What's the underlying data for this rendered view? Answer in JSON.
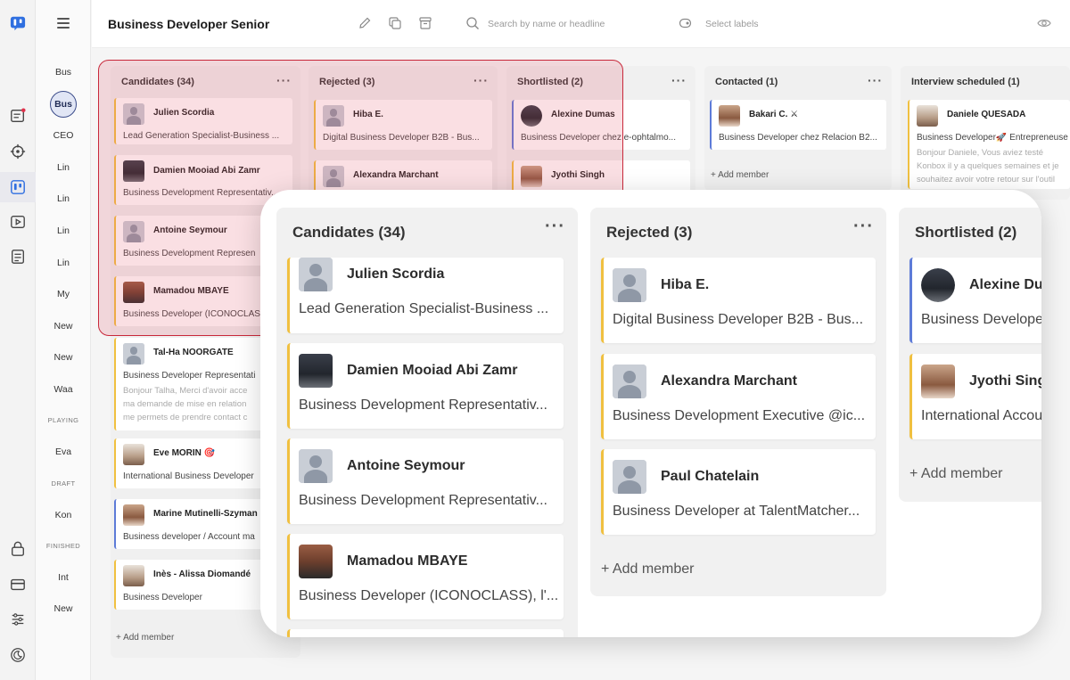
{
  "app": {
    "job_title": "Business Developer Senior"
  },
  "colors": {
    "accent": "#3b4c8a",
    "card_border": "#f0c040",
    "highlight": "#c8283a"
  },
  "header": {
    "search_placeholder": "Search by name or headline",
    "labels_placeholder": "Select labels"
  },
  "jobs": {
    "items": [
      "Bus",
      "Bus",
      "CEO",
      "Lin",
      "Lin",
      "Lin",
      "Lin",
      "My",
      "New",
      "New",
      "Waa"
    ],
    "playing_label": "PLAYING",
    "playing_items": [
      "Eva"
    ],
    "draft_label": "DRAFT",
    "draft_items": [
      "Kon"
    ],
    "finished_label": "FINISHED",
    "finished_items": [
      "Int",
      "New"
    ]
  },
  "board": {
    "add_member": "+ Add member",
    "columns": [
      {
        "title": "Candidates (34)",
        "cards": [
          {
            "name": "Julien Scordia",
            "headline": "Lead Generation Specialist-Business ..."
          },
          {
            "name": "Damien Mooiad Abi Zamr",
            "headline": "Business Development Representativ..."
          },
          {
            "name": "Antoine Seymour",
            "headline": "Business Development Represen"
          },
          {
            "name": "Mamadou MBAYE",
            "headline": "Business Developer (ICONOCLAS"
          },
          {
            "name": "Tal-Ha NOORGATE",
            "headline": "Business Developer Representati",
            "message": [
              "Bonjour Talha, Merci d'avoir acce",
              "ma demande de mise en relation",
              "me permets de prendre contact c"
            ]
          },
          {
            "name": "Eve MORIN 🎯",
            "headline": "International Business Developer"
          },
          {
            "name": "Marine Mutinelli-Szyman",
            "headline": "Business developer / Account ma"
          },
          {
            "name": "Inès - Alissa Diomandé",
            "headline": "Business Developer"
          }
        ]
      },
      {
        "title": "Rejected (3)",
        "cards": [
          {
            "name": "Hiba E.",
            "headline": "Digital Business Developer B2B - Bus..."
          },
          {
            "name": "Alexandra Marchant",
            "headline": ""
          }
        ]
      },
      {
        "title": "Shortlisted (2)",
        "cards": [
          {
            "name": "Alexine Dumas",
            "headline": "Business Developer chez e-ophtalmo..."
          },
          {
            "name": "Jyothi Singh",
            "headline": ""
          }
        ]
      },
      {
        "title": "Contacted (1)",
        "cards": [
          {
            "name": "Bakari C. ⚔",
            "headline": "Business Developer chez Relacion B2..."
          }
        ]
      },
      {
        "title": "Interview scheduled (1)",
        "cards": [
          {
            "name": "Daniele QUESADA",
            "headline": "Business Developer🚀 Entrepreneuse",
            "message": [
              "Bonjour Daniele, Vous aviez testé",
              "Konbox il y a quelques semaines et je",
              "souhaitez avoir votre retour sur l'outil"
            ]
          }
        ]
      }
    ]
  },
  "zoom": {
    "columns": [
      {
        "title": "Candidates (34)",
        "cards": [
          {
            "name": "Julien Scordia",
            "headline": "Lead Generation Specialist-Business ..."
          },
          {
            "name": "Damien Mooiad Abi Zamr",
            "headline": "Business Development Representativ..."
          },
          {
            "name": "Antoine Seymour",
            "headline": "Business Development Representativ..."
          },
          {
            "name": "Mamadou MBAYE",
            "headline": "Business Developer (ICONOCLASS), l'..."
          }
        ]
      },
      {
        "title": "Rejected (3)",
        "cards": [
          {
            "name": "Hiba E.",
            "headline": "Digital Business Developer B2B - Bus..."
          },
          {
            "name": "Alexandra Marchant",
            "headline": "Business Development Executive @ic..."
          },
          {
            "name": "Paul Chatelain",
            "headline": "Business Developer at TalentMatcher..."
          }
        ]
      },
      {
        "title": "Shortlisted (2)",
        "cards": [
          {
            "name": "Alexine Du",
            "headline": "Business Develope"
          },
          {
            "name": "Jyothi Sing",
            "headline": "International Accou"
          }
        ]
      }
    ]
  }
}
